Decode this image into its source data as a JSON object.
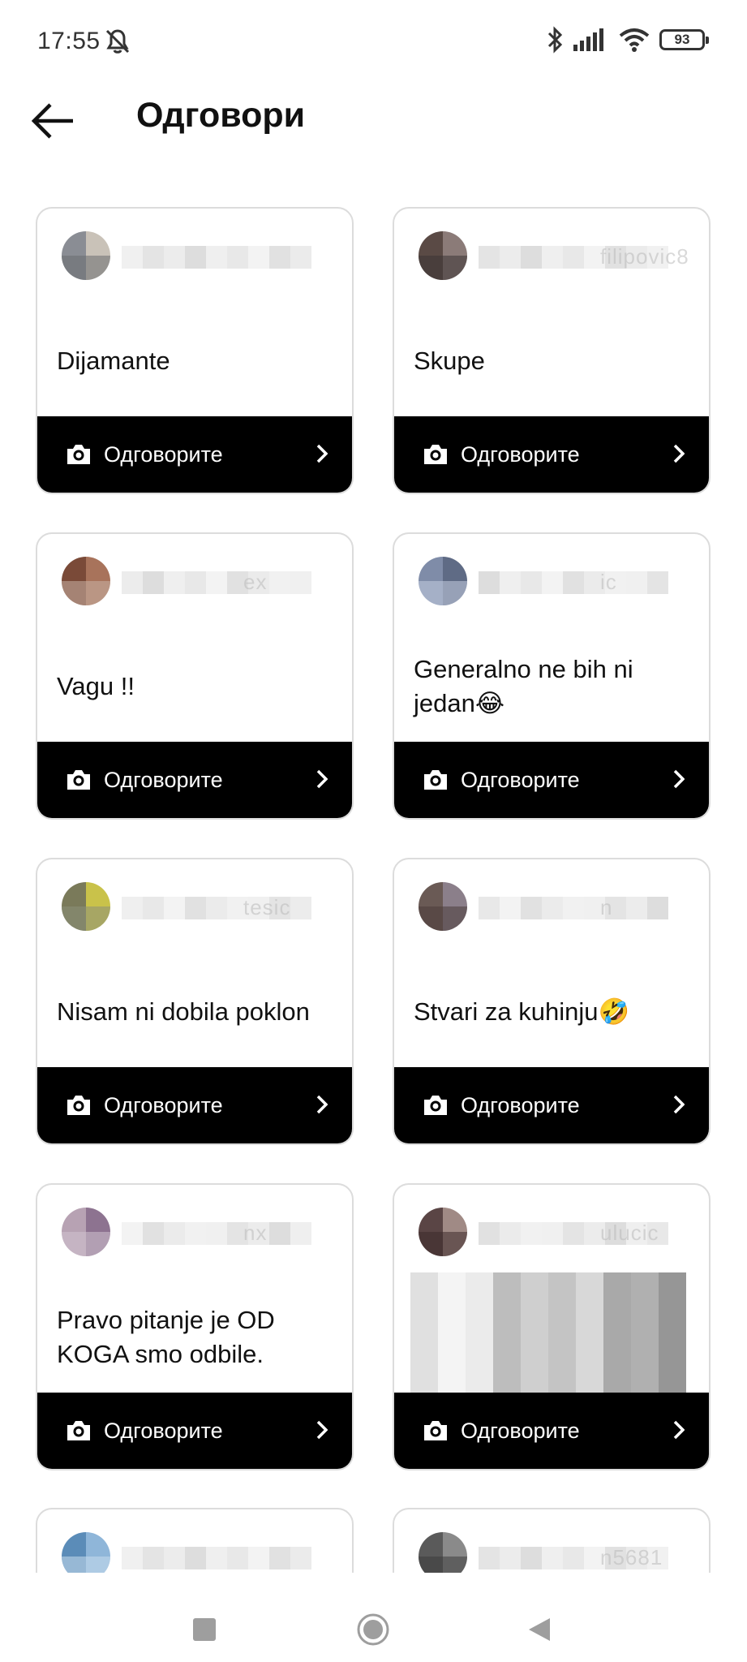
{
  "status_bar": {
    "time": "17:55",
    "battery": "93"
  },
  "header": {
    "title": "Одговори"
  },
  "reply_label": "Одговорите",
  "cards": [
    {
      "answer": "Dijamante",
      "username": "",
      "avatar": [
        "#8a8d94",
        "#c9c2b8",
        "#6a6d70"
      ]
    },
    {
      "answer": "Skupe",
      "username": "filipovic8",
      "avatar": [
        "#5a4a45",
        "#8b7b78",
        "#3c3434"
      ]
    },
    {
      "answer": "Vagu !!",
      "username": "ex",
      "avatar": [
        "#7a4a38",
        "#a8735b",
        "#c9b3a5"
      ]
    },
    {
      "answer": "Generalno ne bih ni jedan😂",
      "username": "ic",
      "avatar": [
        "#7f8ca8",
        "#5f6b85",
        "#c5cde0"
      ]
    },
    {
      "answer": "Nisam ni dobila poklon",
      "username": "tesic",
      "avatar": [
        "#7a7a5a",
        "#c9c24a",
        "#8b8f7a"
      ]
    },
    {
      "answer": "Stvari za kuhinju🤣",
      "username": "n",
      "avatar": [
        "#6a5a55",
        "#8b7f8a",
        "#4a3c3a"
      ]
    },
    {
      "answer": "Pravo pitanje je OD KOGA smo odbile.",
      "username": "nx",
      "avatar": [
        "#b7a2b3",
        "#8d7390",
        "#d1c3cf"
      ]
    },
    {
      "answer": "",
      "username": "ulucic",
      "avatar": [
        "#5a4545",
        "#a08a85",
        "#3c2a2a"
      ]
    }
  ],
  "partial_cards": [
    {
      "username": "",
      "avatar": [
        "#5b8cb8",
        "#8fb6d9",
        "#c9dcec"
      ]
    },
    {
      "username": "n5681",
      "avatar": [
        "#5a5a5a",
        "#8a8a8a",
        "#3c3c3c"
      ]
    }
  ],
  "icons": {
    "mute": "bell-slash-icon",
    "bluetooth": "bluetooth-icon",
    "signal": "signal-icon",
    "wifi": "wifi-icon",
    "battery": "battery-icon",
    "back": "arrow-left-icon",
    "camera": "camera-icon",
    "chevron": "chevron-right-icon"
  }
}
